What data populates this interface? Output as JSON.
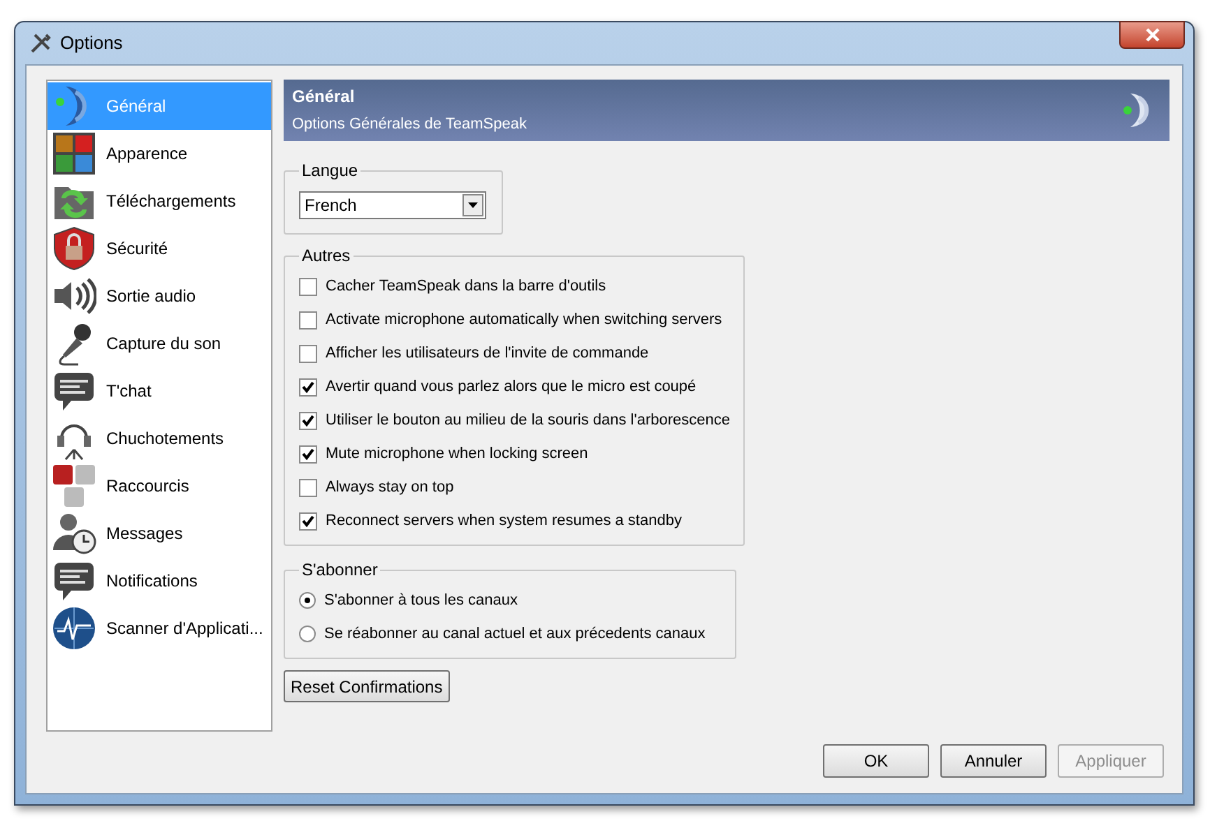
{
  "window": {
    "title": "Options"
  },
  "sidebar": {
    "items": [
      {
        "label": "Général",
        "selected": true
      },
      {
        "label": "Apparence",
        "selected": false
      },
      {
        "label": "Téléchargements",
        "selected": false
      },
      {
        "label": "Sécurité",
        "selected": false
      },
      {
        "label": "Sortie audio",
        "selected": false
      },
      {
        "label": "Capture du son",
        "selected": false
      },
      {
        "label": "T'chat",
        "selected": false
      },
      {
        "label": "Chuchotements",
        "selected": false
      },
      {
        "label": "Raccourcis",
        "selected": false
      },
      {
        "label": "Messages",
        "selected": false
      },
      {
        "label": "Notifications",
        "selected": false
      },
      {
        "label": "Scanner d'Applicati...",
        "selected": false
      }
    ]
  },
  "header": {
    "title": "Général",
    "subtitle": "Options Générales de TeamSpeak"
  },
  "language_group": {
    "title": "Langue",
    "value": "French"
  },
  "others_group": {
    "title": "Autres",
    "options": [
      {
        "label": "Cacher TeamSpeak dans la barre d'outils",
        "checked": false
      },
      {
        "label": "Activate microphone automatically when switching servers",
        "checked": false
      },
      {
        "label": "Afficher les utilisateurs de l'invite de commande",
        "checked": false
      },
      {
        "label": "Avertir quand vous parlez alors que le micro est coupé",
        "checked": true
      },
      {
        "label": "Utiliser le bouton au milieu de la souris dans l'arborescence",
        "checked": true
      },
      {
        "label": "Mute microphone when locking screen",
        "checked": true
      },
      {
        "label": "Always stay on top",
        "checked": false
      },
      {
        "label": "Reconnect servers when system resumes a standby",
        "checked": true
      }
    ]
  },
  "subscribe_group": {
    "title": "S'abonner",
    "options": [
      {
        "label": "S'abonner à tous les canaux",
        "selected": true
      },
      {
        "label": "Se réabonner au canal actuel et aux précedents canaux",
        "selected": false
      }
    ]
  },
  "reset_button": "Reset Confirmations",
  "buttons": [
    {
      "label": "OK",
      "disabled": false
    },
    {
      "label": "Annuler",
      "disabled": false
    },
    {
      "label": "Appliquer",
      "disabled": true
    }
  ]
}
